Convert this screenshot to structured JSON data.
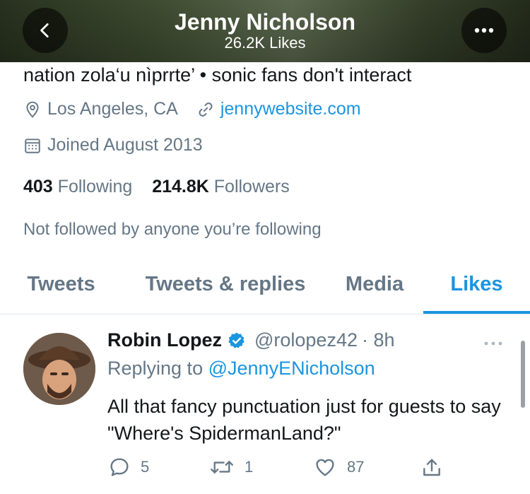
{
  "header": {
    "title": "Jenny Nicholson",
    "subtitle": "26.2K Likes"
  },
  "profile": {
    "bio": "nation zola‘u nìprrte’ • sonic fans don't interact",
    "location": "Los Angeles, CA",
    "website": "jennywebsite.com",
    "joined": "Joined August 2013",
    "following_count": "403",
    "following_label": "Following",
    "followers_count": "214.8K",
    "followers_label": "Followers",
    "not_followed_text": "Not followed by anyone you’re following"
  },
  "tabs": [
    {
      "label": "Tweets",
      "active": false
    },
    {
      "label": "Tweets & replies",
      "active": false
    },
    {
      "label": "Media",
      "active": false
    },
    {
      "label": "Likes",
      "active": true
    }
  ],
  "tweet": {
    "name": "Robin Lopez",
    "handle": "@rolopez42",
    "time": "· 8h",
    "replying_prefix": "Replying to",
    "replying_to": "@JennyENicholson",
    "text": "All that fancy punctuation just for guests to say \"Where's SpidermanLand?\"",
    "replies": "5",
    "retweets": "1",
    "likes": "87"
  },
  "icons": {
    "back": "chevron-left-icon",
    "more": "more-horizontal-icon",
    "location": "location-pin-icon",
    "link": "link-icon",
    "calendar": "calendar-icon",
    "verified": "verified-badge-icon",
    "reply": "reply-icon",
    "retweet": "retweet-icon",
    "like": "heart-icon",
    "share": "share-icon"
  },
  "colors": {
    "accent": "#1b95e0",
    "secondary_text": "#657786",
    "primary_text": "#14171a"
  }
}
